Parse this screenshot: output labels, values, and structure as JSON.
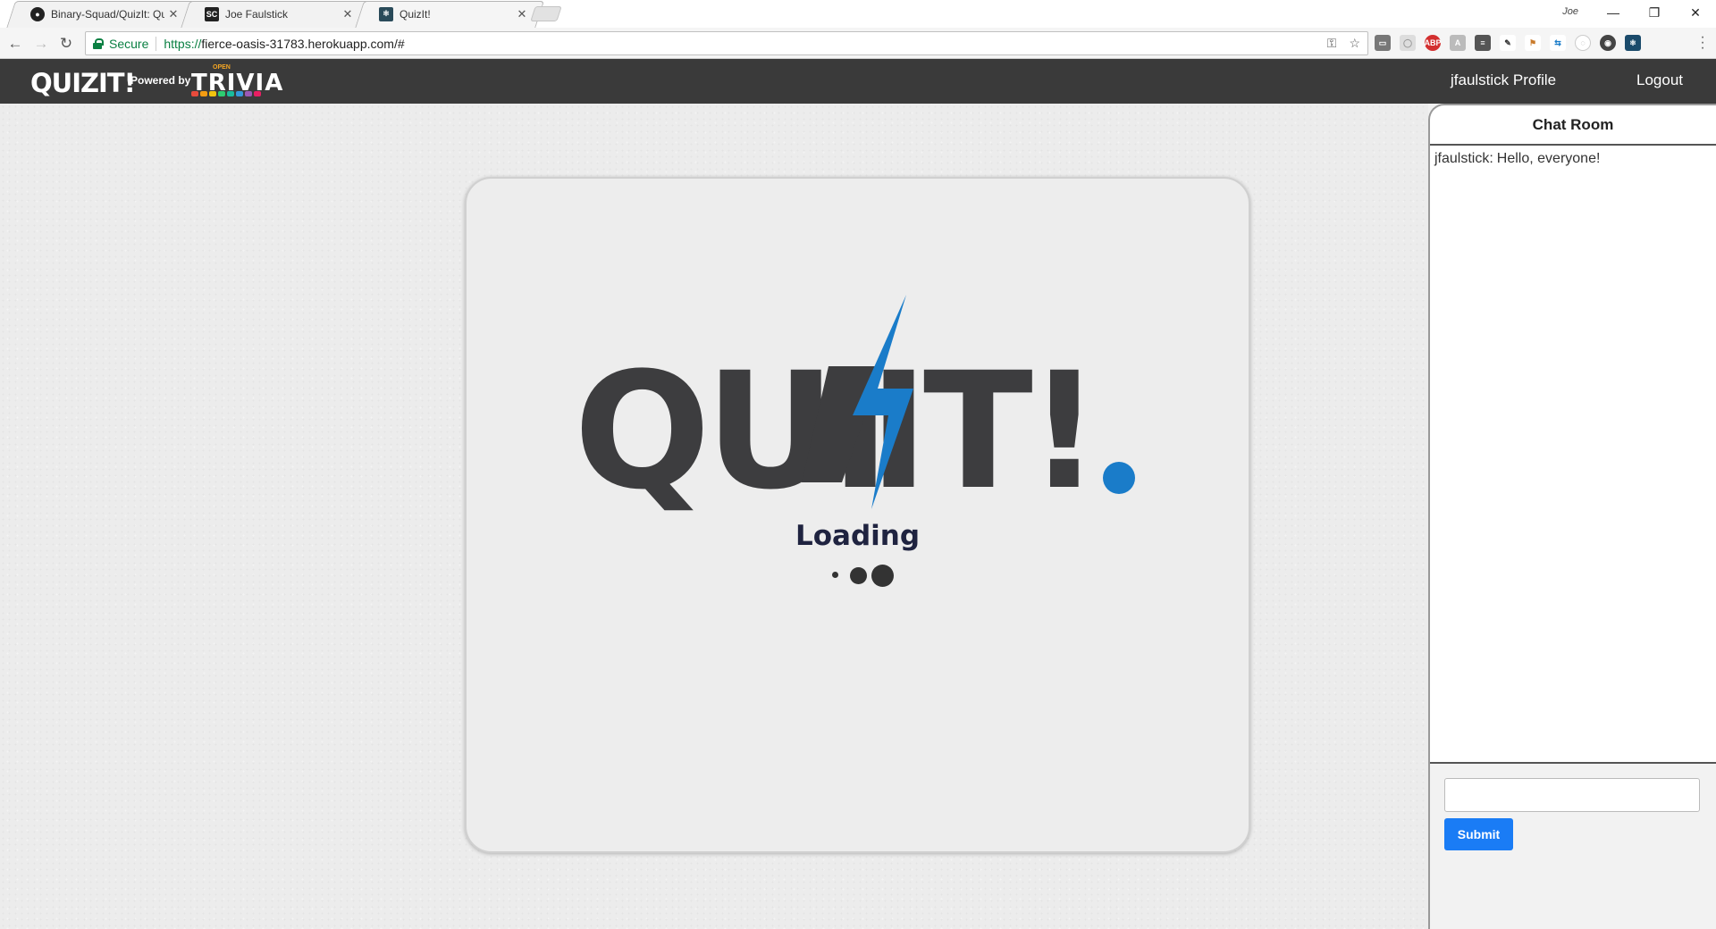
{
  "browser": {
    "tabs": [
      {
        "title": "Binary-Squad/QuizIt: Qu",
        "favicon": "github-icon"
      },
      {
        "title": "Joe Faulstick",
        "favicon": "sc-icon"
      },
      {
        "title": "QuizIt!",
        "favicon": "react-icon"
      }
    ],
    "profile_name": "Joe",
    "security_label": "Secure",
    "url_scheme": "https://",
    "url_rest": "fierce-oasis-31783.herokuapp.com/#"
  },
  "header": {
    "brand": "QUIZIT!",
    "powered_by": "Powered by",
    "trivia_open": "OPEN",
    "trivia_word": "TRIVIA",
    "profile_link": "jfaulstick Profile",
    "logout_link": "Logout"
  },
  "main": {
    "logo_text_left": "QUI",
    "logo_text_right": "IT!",
    "loading_text": "Loading",
    "accent_color": "#1a7cc9"
  },
  "chat": {
    "title": "Chat Room",
    "messages": [
      {
        "user": "jfaulstick:",
        "text": "Hello, everyone!"
      }
    ],
    "input_value": "",
    "submit_label": "Submit"
  }
}
